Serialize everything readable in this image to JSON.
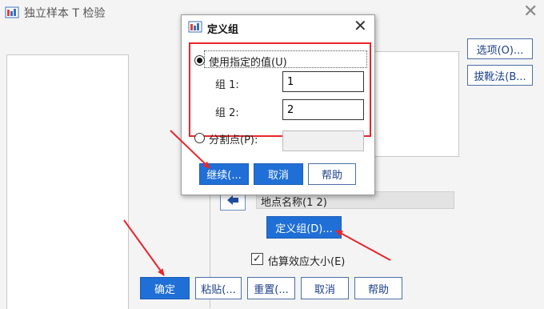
{
  "main": {
    "title": "独立样本 T 检验",
    "options_label": "选项(O)...",
    "bootstrap_label": "拔靴法(B...",
    "grouping_var": "地点名称(1 2)",
    "define_groups_label": "定义组(D)...",
    "effect_size_label": "估算效应大小(E)",
    "effect_size_checked": true,
    "ok_label": "确定",
    "paste_label": "粘贴(...",
    "reset_label": "重置(...",
    "cancel_label": "取消",
    "help_label": "帮助"
  },
  "dialog": {
    "title": "定义组",
    "use_values_label": "使用指定的值(U)",
    "group1_label": "组 1:",
    "group1_value": "1",
    "group2_label": "组 2:",
    "group2_value": "2",
    "cutpoint_label": "分割点(P):",
    "continue_label": "继续(...",
    "cancel_label": "取消",
    "help_label": "帮助"
  },
  "colors": {
    "accent": "#1f6fd6",
    "highlight": "#e8262a",
    "annotation_arrow": "#e8262a"
  }
}
